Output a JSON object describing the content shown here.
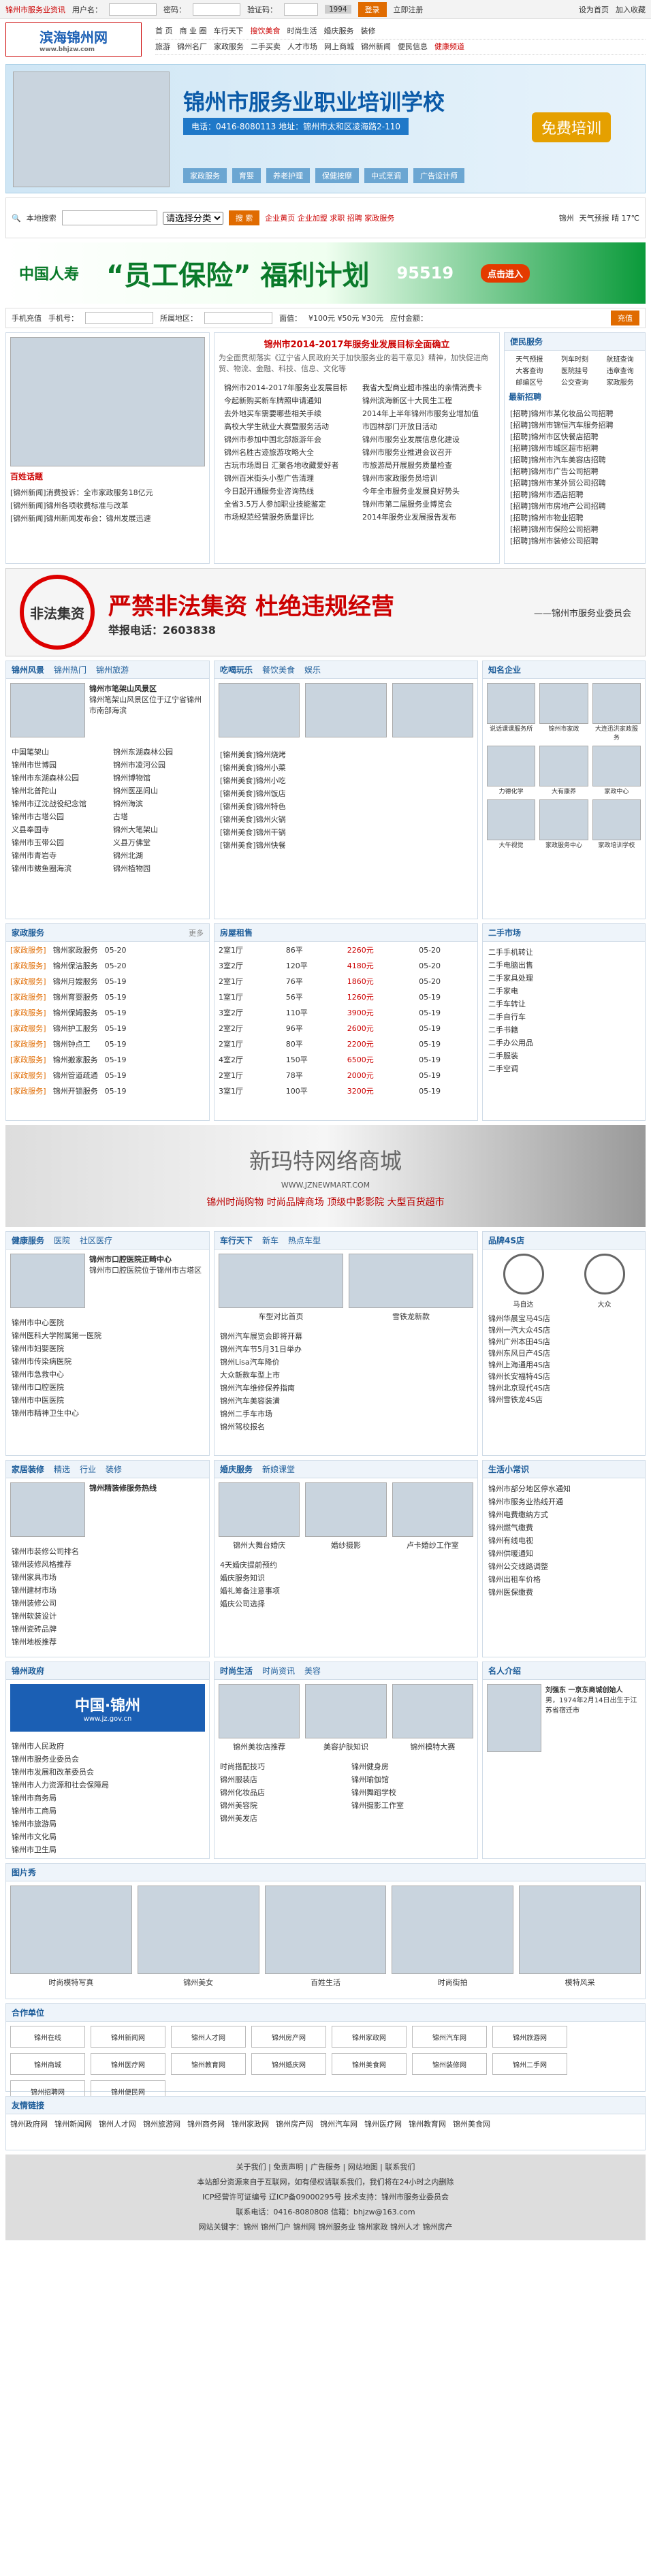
{
  "topbar": {
    "tagline": "锦州市服务业资讯",
    "user_label": "用户名：",
    "pass_label": "密码：",
    "code_label": "验证码：",
    "captcha": "1994",
    "login": "登录",
    "register": "立即注册",
    "homepage": "设为首页",
    "fav": "加入收藏"
  },
  "logo": {
    "title": "滨海锦州网",
    "url": "www.bhjzw.com"
  },
  "nav": {
    "row1": [
      "首 页",
      "商 业 圈",
      "车行天下",
      "搜饮美食",
      "时尚生活",
      "婚庆服务",
      "装修"
    ],
    "row1_hot": "搜饮美食",
    "row2": [
      "旅游",
      "锦州名厂",
      "家政服务",
      "二手买卖",
      "人才市场",
      "网上商城"
    ],
    "row3": [
      "家政",
      "锦州新闻",
      "便民信息",
      "健康频道"
    ]
  },
  "banner": {
    "title": "锦州市服务业职业培训学校",
    "tel": "电话：0416-8080113  地址：锦州市太和区凌海路2-110",
    "free": "免费培训",
    "items": [
      "家政服务",
      "育婴",
      "养老护理",
      "保健按摩",
      "中式烹调",
      "广告设计师"
    ]
  },
  "search": {
    "label": "本地搜索",
    "placeholder": "",
    "category": "请选择分类",
    "button": "搜 索",
    "links": "企业黄页 企业加盟 求职 招聘 家政服务",
    "weather_city": "锦州",
    "weather": "天气预报 晴 17℃"
  },
  "ad1": {
    "brand": "中国人寿",
    "slogan": "“员工保险” 福利计划",
    "num": "95519",
    "cta": "点击进入"
  },
  "phonebar": {
    "label": "手机充值",
    "phone": "手机号：",
    "area": "所属地区：",
    "amount": "面值：",
    "opts": "¥100元 ¥50元 ¥30元",
    "pay": "应付金额：",
    "btn": "充值"
  },
  "news": {
    "headline": "锦州市2014-2017年服务业发展目标全面确立",
    "intro": "为全面贯彻落实《辽宁省人民政府关于加快服务业的若干意见》精神，加快促进商贸、物流、金融、科技、信息、文化等",
    "items": [
      "锦州市2014-2017年服务业发展目标",
      "今起新购买新车牌照申请通知",
      "去外地买车需要哪些相关手续",
      "高校大学生就业大赛暨服务活动",
      "锦州市参加中国北部旅游年会",
      "锦州名胜古迹旅游攻略大全",
      "古玩市场周日 汇聚各地收藏爱好者",
      "锦州百米街头小型广告清理",
      "今日起开通服务业咨询热线",
      "全省3.5万人参加职业技能鉴定",
      "市场规范经营服务质量评比"
    ],
    "items2": [
      "我省大型商业超市推出的亲情消费卡",
      "锦州滨海新区十大民生工程",
      "2014年上半年锦州市服务业增加值",
      "市园林部门开放日活动",
      "锦州市服务业发展信息化建设",
      "锦州市服务业推进会议召开",
      "市旅游局开展服务质量检查",
      "锦州市家政服务员培训",
      "今年全市服务业发展良好势头",
      "锦州市第二届服务业博览会",
      "2014年服务业发展报告发布"
    ],
    "community_title": "百姓话题",
    "community": [
      "[锦州新闻]消费投诉：全市家政服务18亿元",
      "[锦州新闻]锦州各项收费标准与改革",
      "[锦州新闻]锦州新闻发布会：锦州发展迅速"
    ]
  },
  "rightpanel": {
    "title": "便民服务",
    "cells": [
      "天气预报",
      "列车时刻",
      "航班查询",
      "大客查询",
      "医院挂号",
      "违章查询",
      "邮编区号",
      "公交查询",
      "家政服务"
    ],
    "latest_title": "最新招聘",
    "latest": [
      "[招聘]锦州市某化妆品公司招聘",
      "[招聘]锦州市锦恒汽车服务招聘",
      "[招聘]锦州市区快餐店招聘",
      "[招聘]锦州市城区超市招聘",
      "[招聘]锦州市汽车美容店招聘",
      "[招聘]锦州市广告公司招聘",
      "[招聘]锦州市某外贸公司招聘",
      "[招聘]锦州市酒店招聘",
      "[招聘]锦州市房地产公司招聘",
      "[招聘]锦州市物业招聘",
      "[招聘]锦州市保险公司招聘",
      "[招聘]锦州市装修公司招聘"
    ]
  },
  "ad2": {
    "stamp": "非法集资",
    "title": "严禁非法集资  杜绝违规经营",
    "tel": "举报电话：2603838",
    "org": "——锦州市服务业委员会"
  },
  "scenic": {
    "title": "锦州风景",
    "tabs": [
      "锦州热门",
      "锦州旅游"
    ],
    "featured": "锦州市笔架山风景区",
    "desc": "锦州笔架山风景区位于辽宁省锦州市南部海滨",
    "links": [
      "中国笔架山",
      "锦州市世博园",
      "锦州市东湖森林公园",
      "锦州北普陀山",
      "锦州市辽沈战役纪念馆",
      "锦州市古塔公园",
      "义县奉国寺",
      "锦州市玉带公园",
      "锦州市青岩寺",
      "锦州市鲅鱼圈海滨"
    ],
    "links2": [
      "锦州东湖森林公园",
      "锦州市凌河公园",
      "锦州博物馆",
      "锦州医巫闾山",
      "锦州海滨",
      "古塔",
      "锦州大笔架山",
      "义县万佛堂",
      "锦州北湖",
      "锦州植物园"
    ]
  },
  "food": {
    "title": "吃喝玩乐",
    "tabs": [
      "餐饮美食",
      "娱乐"
    ],
    "items": [
      "[锦州美食]锦州烧烤",
      "[锦州美食]锦州小菜",
      "[锦州美食]锦州小吃",
      "[锦州美食]锦州饭店",
      "[锦州美食]锦州特色",
      "[锦州美食]锦州火锅",
      "[锦州美食]锦州干锅",
      "[锦州美食]锦州快餐"
    ]
  },
  "services": {
    "title": "知名企业",
    "items": [
      "说话课课服务所",
      "锦州市家政",
      "大连迅洪家政服务",
      "力德化学",
      "大有康养",
      "家政中心",
      "大午视觉",
      "家政服务中心",
      "家政培训学校"
    ]
  },
  "jobs": {
    "title": "家政服务",
    "more": "更多",
    "rows": [
      [
        "[家政服务]",
        "锦州家政服务",
        "05-20"
      ],
      [
        "[家政服务]",
        "锦州保洁服务",
        "05-20"
      ],
      [
        "[家政服务]",
        "锦州月嫂服务",
        "05-19"
      ],
      [
        "[家政服务]",
        "锦州育婴服务",
        "05-19"
      ],
      [
        "[家政服务]",
        "锦州保姆服务",
        "05-19"
      ],
      [
        "[家政服务]",
        "锦州护工服务",
        "05-19"
      ],
      [
        "[家政服务]",
        "锦州钟点工",
        "05-19"
      ],
      [
        "[家政服务]",
        "锦州搬家服务",
        "05-19"
      ],
      [
        "[家政服务]",
        "锦州管道疏通",
        "05-19"
      ],
      [
        "[家政服务]",
        "锦州开锁服务",
        "05-19"
      ]
    ]
  },
  "rent": {
    "title": "房屋租售",
    "rows": [
      [
        "2室1厅",
        "86平",
        "2260元",
        "05-20"
      ],
      [
        "3室2厅",
        "120平",
        "4180元",
        "05-20"
      ],
      [
        "2室1厅",
        "76平",
        "1860元",
        "05-20"
      ],
      [
        "1室1厅",
        "56平",
        "1260元",
        "05-19"
      ],
      [
        "3室2厅",
        "110平",
        "3900元",
        "05-19"
      ],
      [
        "2室2厅",
        "96平",
        "2600元",
        "05-19"
      ],
      [
        "2室1厅",
        "80平",
        "2200元",
        "05-19"
      ],
      [
        "4室2厅",
        "150平",
        "6500元",
        "05-19"
      ],
      [
        "2室1厅",
        "78平",
        "2000元",
        "05-19"
      ],
      [
        "3室1厅",
        "100平",
        "3200元",
        "05-19"
      ]
    ]
  },
  "used": {
    "title": "二手市场",
    "items": [
      "二手手机转让",
      "二手电脑出售",
      "二手家具处理",
      "二手家电",
      "二手车转让",
      "二手自行车",
      "二手书籍",
      "二手办公用品",
      "二手服装",
      "二手空调"
    ]
  },
  "ad3": {
    "title": "新玛特网络商城",
    "url": "WWW.JZNEWMART.COM",
    "slogan": "锦州时尚购物  时尚品牌商场  顶级中影影院  大型百货超市"
  },
  "health": {
    "title": "健康服务",
    "tabs": [
      "医院",
      "社区医疗"
    ],
    "featured": "锦州市口腔医院正畸中心",
    "desc": "锦州市口腔医院位于锦州市古塔区",
    "items": [
      "锦州市中心医院",
      "锦州医科大学附属第一医院",
      "锦州市妇婴医院",
      "锦州市传染病医院",
      "锦州市急救中心",
      "锦州市口腔医院",
      "锦州市中医医院",
      "锦州市精神卫生中心"
    ]
  },
  "cars": {
    "title": "车行天下",
    "tabs": [
      "新车",
      "热点车型"
    ],
    "cards": [
      "车型对比首页",
      "雪铁龙新款"
    ],
    "items": [
      "锦州汽车展览会即将开幕",
      "锦州汽车节5月31日举办",
      "锦州Lisa汽车降价",
      "大众新款车型上市",
      "锦州汽车维修保养指南",
      "锦州汽车美容装潢",
      "锦州二手车市场",
      "锦州驾校报名"
    ]
  },
  "brands": {
    "title": "品牌4S店",
    "names": [
      "马自达",
      "大众",
      "一汽",
      "雷诺"
    ],
    "list": [
      "锦州华晨宝马4S店",
      "锦州一汽大众4S店",
      "锦州广州本田4S店",
      "锦州东风日产4S店",
      "锦州上海通用4S店",
      "锦州长安福特4S店",
      "锦州北京现代4S店",
      "锦州雪铁龙4S店",
      "锦州奇瑞4S店",
      "锦州吉利4S店"
    ]
  },
  "decor": {
    "title": "家居装修",
    "tabs": [
      "精选",
      "行业",
      "装修"
    ],
    "featured": "锦州精装修服务热线",
    "items": [
      "锦州市装修公司排名",
      "锦州装修风格推荐",
      "锦州家具市场",
      "锦州建材市场",
      "锦州装修公司",
      "锦州软装设计",
      "锦州瓷砖品牌",
      "锦州地板推荐"
    ]
  },
  "wedding": {
    "title": "婚庆服务",
    "tabs": [
      "新娘课堂"
    ],
    "cards": [
      "锦州大舞台婚庆",
      "婚纱摄影",
      "卢卡婚纱工作室"
    ],
    "items": [
      "4天婚庆提前预约",
      "婚庆服务知识",
      "婚礼筹备注意事项",
      "婚庆公司选择"
    ]
  },
  "lifetips": {
    "title": "生活小常识",
    "items": [
      "锦州市部分地区停水通知",
      "锦州市服务业热线开通",
      "锦州电费缴纳方式",
      "锦州燃气缴费",
      "锦州有线电视",
      "锦州供暖通知",
      "锦州公交线路调整",
      "锦州出租车价格",
      "锦州医保缴费"
    ]
  },
  "gov": {
    "title": "锦州政府",
    "banner": "中国·锦州",
    "url": "www.jz.gov.cn",
    "items": [
      "锦州市人民政府",
      "锦州市服务业委员会",
      "锦州市发展和改革委员会",
      "锦州市人力资源和社会保障局",
      "锦州市商务局",
      "锦州市工商局",
      "锦州市旅游局",
      "锦州市文化局",
      "锦州市卫生局"
    ]
  },
  "fashion": {
    "title": "时尚生活",
    "tabs": [
      "时尚资讯",
      "美容"
    ],
    "cards": [
      "锦州美妆店推荐",
      "美容护肤知识",
      "锦州模特大赛"
    ],
    "items": [
      "时尚搭配技巧",
      "锦州服装店",
      "锦州化妆品店",
      "锦州美容院",
      "锦州美发店",
      "锦州健身房",
      "锦州瑜伽馆",
      "锦州舞蹈学校",
      "锦州摄影工作室"
    ]
  },
  "person": {
    "title": "名人介绍",
    "name": "刘强东 一京东商城创始人",
    "desc": "男，1974年2月14日出生于江苏省宿迁市"
  },
  "gallery": {
    "title": "图片秀",
    "items": [
      "时尚模特写真",
      "锦州美女",
      "百姓生活",
      "时尚街拍",
      "模特风采"
    ]
  },
  "partners": {
    "title": "合作单位",
    "items": [
      "锦州在线",
      "锦州新闻网",
      "锦州人才网",
      "锦州房产网",
      "锦州家政网",
      "锦州汽车网",
      "锦州旅游网",
      "锦州商城",
      "锦州医疗网",
      "锦州教育网",
      "锦州婚庆网",
      "锦州美食网",
      "锦州装修网",
      "锦州二手网",
      "锦州招聘网",
      "锦州便民网"
    ]
  },
  "friends": {
    "title": "友情链接",
    "items": [
      "锦州政府网",
      "锦州新闻网",
      "锦州人才网",
      "锦州旅游网",
      "锦州商务网",
      "锦州家政网",
      "锦州房产网",
      "锦州汽车网",
      "锦州医疗网",
      "锦州教育网",
      "锦州美食网"
    ]
  },
  "footer": {
    "links": "关于我们 | 免责声明 | 广告服务 | 网站地图 | 联系我们",
    "line1": "本站部分资源来自于互联网，如有侵权请联系我们，我们将在24小时之内删除",
    "line2": "ICP经营许可证编号 辽ICP备09000295号  技术支持：锦州市服务业委员会",
    "line3": "联系电话：0416-8080808  信箱：bhjzw@163.com",
    "line4": "网站关键字：锦州 锦州门户 锦州网 锦州服务业 锦州家政 锦州人才 锦州房产"
  }
}
